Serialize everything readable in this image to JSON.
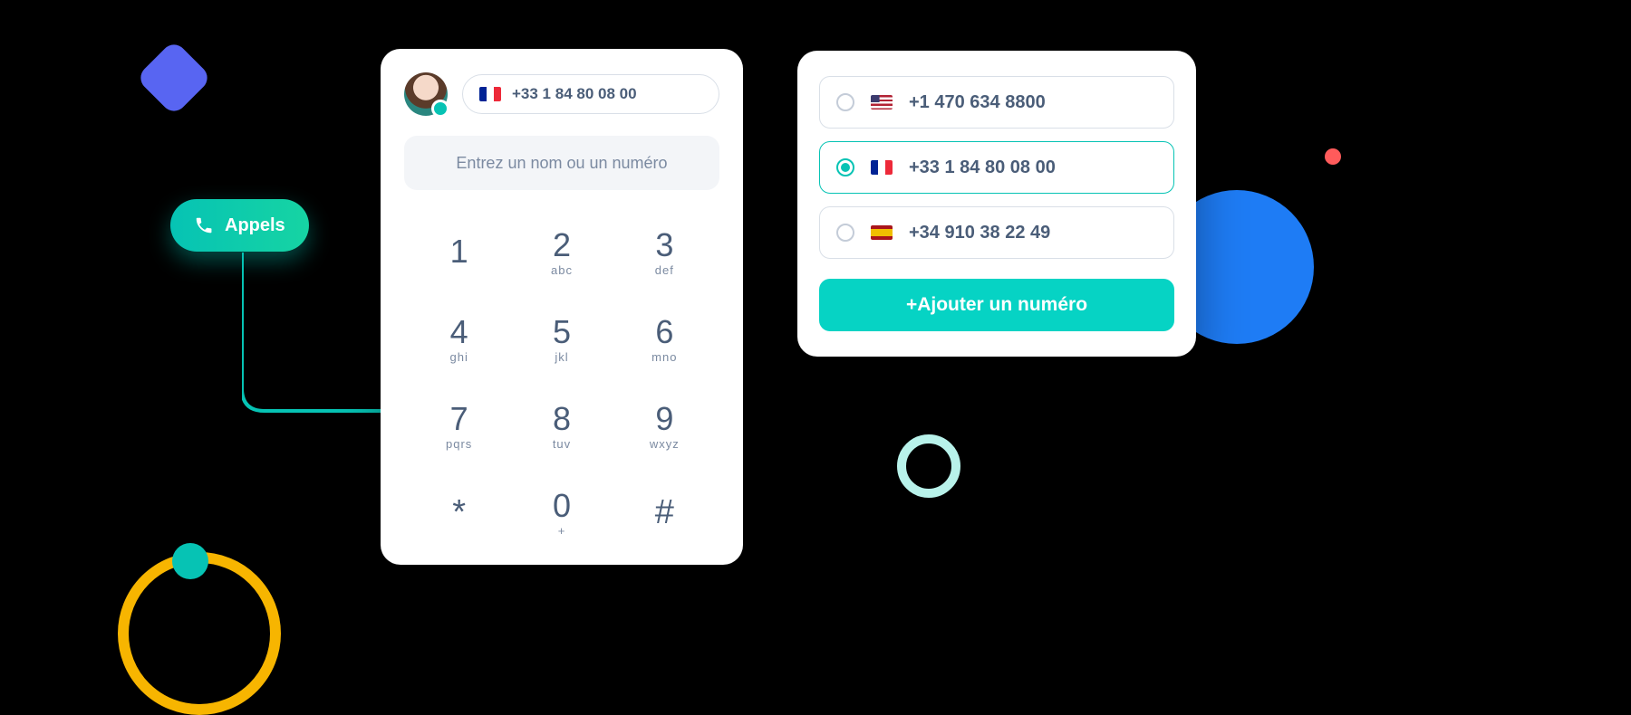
{
  "appels": {
    "label": "Appels"
  },
  "dialer": {
    "current_number_flag": "fr",
    "current_number": "+33 1 84 80 08 00",
    "search_placeholder": "Entrez un nom ou un numéro",
    "keys": [
      {
        "digit": "1",
        "letters": ""
      },
      {
        "digit": "2",
        "letters": "abc"
      },
      {
        "digit": "3",
        "letters": "def"
      },
      {
        "digit": "4",
        "letters": "ghi"
      },
      {
        "digit": "5",
        "letters": "jkl"
      },
      {
        "digit": "6",
        "letters": "mno"
      },
      {
        "digit": "7",
        "letters": "pqrs"
      },
      {
        "digit": "8",
        "letters": "tuv"
      },
      {
        "digit": "9",
        "letters": "wxyz"
      },
      {
        "digit": "*",
        "letters": ""
      },
      {
        "digit": "0",
        "letters": "+"
      },
      {
        "digit": "#",
        "letters": ""
      }
    ]
  },
  "numbers": {
    "items": [
      {
        "flag": "us",
        "number": "+1 470 634 8800",
        "selected": false
      },
      {
        "flag": "fr",
        "number": "+33 1 84 80 08 00",
        "selected": true
      },
      {
        "flag": "es",
        "number": "+34 910 38 22 49",
        "selected": false
      }
    ],
    "add_label": "+Ajouter un numéro"
  },
  "colors": {
    "accent": "#06c3b4",
    "blue_blob": "#1e7cf5",
    "diamond": "#5865f2",
    "coral": "#ff5b5b",
    "ring_yellow": "#f7b500"
  }
}
